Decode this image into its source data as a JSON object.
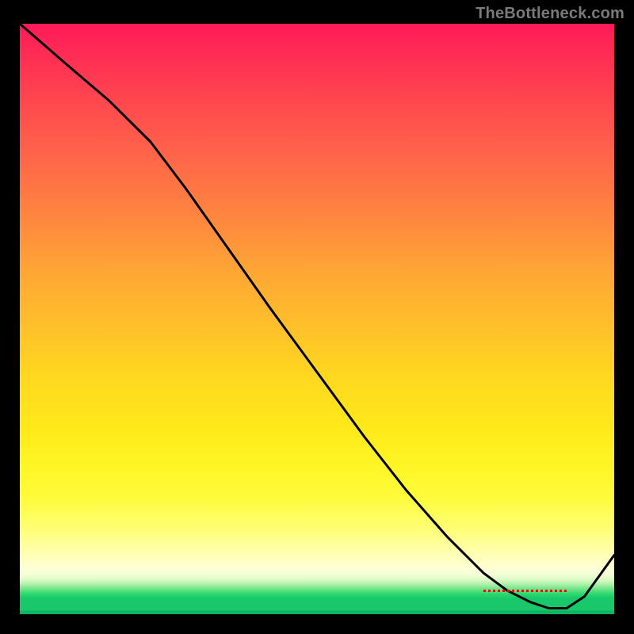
{
  "watermark": "TheBottleneck.com",
  "chart_data": {
    "type": "line",
    "title": "",
    "xlabel": "",
    "ylabel": "",
    "xlim": [
      0,
      100
    ],
    "ylim": [
      0,
      100
    ],
    "grid": false,
    "series": [
      {
        "name": "curve",
        "x": [
          0,
          8,
          15,
          22,
          28,
          35,
          42,
          50,
          58,
          65,
          72,
          78,
          82,
          86,
          89,
          92,
          95,
          100
        ],
        "y": [
          100,
          93,
          87,
          80,
          72,
          62,
          52,
          41,
          30,
          21,
          13,
          7,
          4,
          2,
          1,
          1,
          3,
          10
        ]
      }
    ],
    "optimal_region_x": [
      78,
      92
    ],
    "gradient_stops": [
      {
        "pos": 0.0,
        "color": "#ff1a58"
      },
      {
        "pos": 0.4,
        "color": "#ff8a3e"
      },
      {
        "pos": 0.7,
        "color": "#ffe81a"
      },
      {
        "pos": 0.92,
        "color": "#ffffd4"
      },
      {
        "pos": 0.97,
        "color": "#2bd86e"
      },
      {
        "pos": 1.0,
        "color": "#0db561"
      }
    ],
    "bottom_marker_label": ""
  },
  "colors": {
    "background": "#000000",
    "watermark": "#7a7a7a",
    "curve": "#000000",
    "marker": "#d11a0f"
  }
}
